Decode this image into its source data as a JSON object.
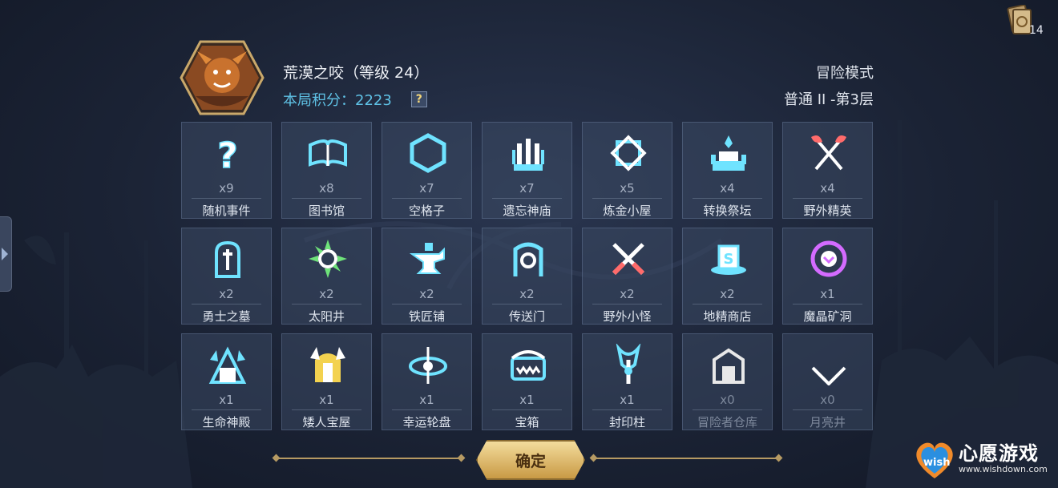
{
  "header": {
    "hero_name": "荒漠之咬（等级 24）",
    "score_label": "本局积分：2223",
    "help_icon": "?",
    "mode": "冒险模式",
    "level": "普通 II -第3层"
  },
  "top_right": {
    "card_count": "14"
  },
  "tiles": [
    {
      "count": "x9",
      "label": "随机事件",
      "icon": "question-icon",
      "color": "#6fe3ff"
    },
    {
      "count": "x8",
      "label": "图书馆",
      "icon": "book-icon",
      "color": "#6fe3ff"
    },
    {
      "count": "x7",
      "label": "空格子",
      "icon": "hexagon-icon",
      "color": "#6fe3ff"
    },
    {
      "count": "x7",
      "label": "遗忘神庙",
      "icon": "temple-icon",
      "color": "#6fe3ff"
    },
    {
      "count": "x5",
      "label": "炼金小屋",
      "icon": "alchemy-icon",
      "color": "#6fe3ff"
    },
    {
      "count": "x4",
      "label": "转换祭坛",
      "icon": "altar-icon",
      "color": "#6fe3ff"
    },
    {
      "count": "x4",
      "label": "野外精英",
      "icon": "crossed-axes-icon",
      "color": "#ff6b6b"
    },
    {
      "count": "x2",
      "label": "勇士之墓",
      "icon": "tomb-icon",
      "color": "#6fe3ff"
    },
    {
      "count": "x2",
      "label": "太阳井",
      "icon": "sun-well-icon",
      "color": "#6fe37a"
    },
    {
      "count": "x2",
      "label": "铁匠铺",
      "icon": "anvil-icon",
      "color": "#6fe3ff"
    },
    {
      "count": "x2",
      "label": "传送门",
      "icon": "portal-icon",
      "color": "#6fe3ff"
    },
    {
      "count": "x2",
      "label": "野外小怪",
      "icon": "crossed-swords-icon",
      "color": "#ff6b6b"
    },
    {
      "count": "x2",
      "label": "地精商店",
      "icon": "shop-icon",
      "color": "#6fe3ff"
    },
    {
      "count": "x1",
      "label": "魔晶矿洞",
      "icon": "crystal-mine-icon",
      "color": "#d46bff"
    },
    {
      "count": "x1",
      "label": "生命神殿",
      "icon": "life-temple-icon",
      "color": "#6fe3ff"
    },
    {
      "count": "x1",
      "label": "矮人宝屋",
      "icon": "dwarf-treasure-icon",
      "color": "#f3d24f"
    },
    {
      "count": "x1",
      "label": "幸运轮盘",
      "icon": "lucky-wheel-icon",
      "color": "#6fe3ff"
    },
    {
      "count": "x1",
      "label": "宝箱",
      "icon": "chest-icon",
      "color": "#6fe3ff"
    },
    {
      "count": "x1",
      "label": "封印柱",
      "icon": "seal-pillar-icon",
      "color": "#6fe3ff"
    },
    {
      "count": "x0",
      "label": "冒险者仓库",
      "icon": "warehouse-icon",
      "color": "#e8e8e8"
    },
    {
      "count": "x0",
      "label": "月亮井",
      "icon": "moon-well-icon",
      "color": "#e8e8e8"
    }
  ],
  "footer": {
    "confirm_label": "确定"
  },
  "watermark": {
    "logo_text": "心愿游戏",
    "logo_wish": "wish",
    "url": "www.wishdown.com"
  }
}
